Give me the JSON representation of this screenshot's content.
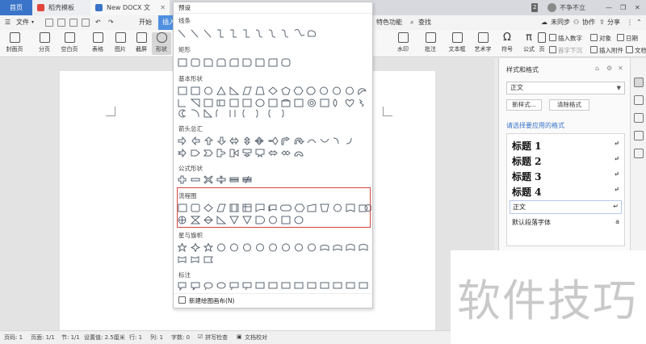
{
  "tabs": {
    "home": "首页",
    "template": "稻壳模板",
    "document": "New DOCX 文档.docx",
    "add": "+"
  },
  "topbar": {
    "badge": "2",
    "user": "不争不立"
  },
  "menu": {
    "file": "文件",
    "start": "开始",
    "insert": "插入",
    "special": "特色功能",
    "find": "查找",
    "sync": "未同步",
    "collab": "协作",
    "share": "分享"
  },
  "ribbon": {
    "cover": "封面页",
    "pagination": "分页",
    "blank": "空白页",
    "table": "表格",
    "picture": "图片",
    "screenshot": "截屏",
    "shape": "形状",
    "watermark": "水印",
    "comment": "批注",
    "textbox": "文本框",
    "wordart": "艺术字",
    "symbol": "符号",
    "formula": "公式",
    "page": "页",
    "insert_number": "插入数字",
    "object": "对象",
    "date": "日期",
    "dropcap": "首字下沉",
    "attachment": "插入附件",
    "docpart": "文档部"
  },
  "shapes": {
    "preset": "预设",
    "lines": "线条",
    "rect": "矩形",
    "basic": "基本形状",
    "arrows": "箭头总汇",
    "formula": "公式形状",
    "flowchart": "流程图",
    "stars": "星与旗帜",
    "callouts": "标注",
    "new_canvas": "新建绘图画布(N)"
  },
  "stylepane": {
    "title": "样式和格式",
    "current": "正文",
    "new_style": "新样式...",
    "clear_format": "清除格式",
    "prompt": "请选择要应用的格式",
    "items": [
      "标题 1",
      "标题 2",
      "标题 3",
      "标题 4",
      "正文",
      "默认段落字体"
    ],
    "return_mark": "↵",
    "font_mark": "a"
  },
  "status": {
    "page_number": "页码: 1",
    "pages": "页面: 1/1",
    "section": "节: 1/1",
    "setting": "设置值: 2.5厘米",
    "row": "行: 1",
    "column": "列: 1",
    "words": "字数: 0",
    "spellcheck": "拼写检查",
    "proofread": "文档校对"
  },
  "watermark_text": "软件技巧",
  "colors": {
    "accent": "#3a74c9",
    "highlight": "#d64541",
    "tab_bar": "#d7d9de"
  }
}
